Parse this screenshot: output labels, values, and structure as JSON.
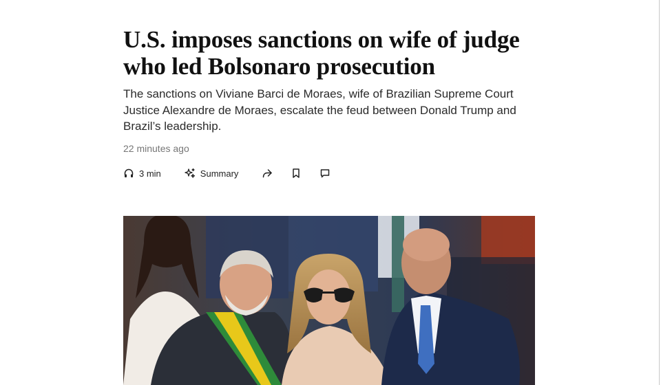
{
  "article": {
    "headline": "U.S. imposes sanctions on wife of judge who led Bolsonaro prosecution",
    "dek": "The sanctions on Viviane Barci de Moraes, wife of Brazilian Supreme Court Justice Alexandre de Moraes, escalate the feud between Donald Trump and Brazil’s leadership.",
    "timestamp": "22 minutes ago"
  },
  "toolbar": {
    "listen_label": "3 min",
    "listen_icon": "headphones-icon",
    "summary_label": "Summary",
    "summary_icon": "sparkle-icon",
    "share_icon": "share-arrow-icon",
    "save_icon": "bookmark-icon",
    "comment_icon": "comment-icon"
  },
  "photo": {
    "subject": "news-photo"
  }
}
